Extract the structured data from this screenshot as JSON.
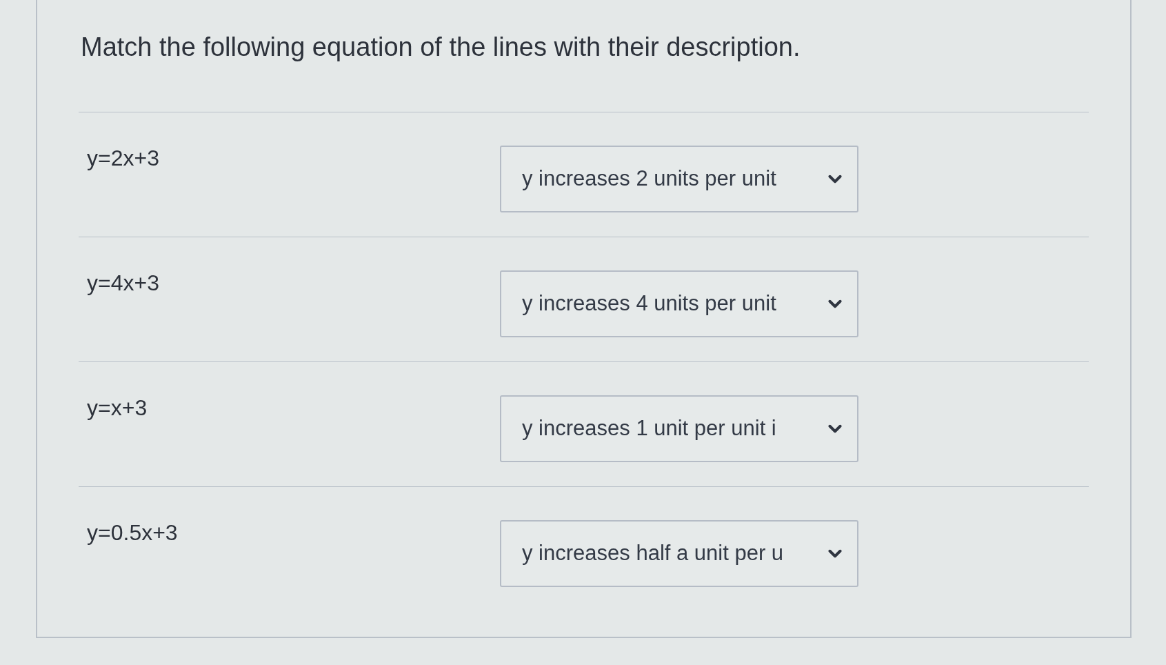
{
  "question": {
    "prompt": "Match the following equation of the lines with their description."
  },
  "rows": [
    {
      "equation": "y=2x+3",
      "answer": {
        "value": "y increases 2 units per unit"
      }
    },
    {
      "equation": "y=4x+3",
      "answer": {
        "value": "y increases 4 units per unit"
      }
    },
    {
      "equation": "y=x+3",
      "answer": {
        "value": "y increases 1 unit per unit i"
      }
    },
    {
      "equation": "y=0.5x+3",
      "answer": {
        "value": "y increases half a unit per u"
      }
    }
  ]
}
